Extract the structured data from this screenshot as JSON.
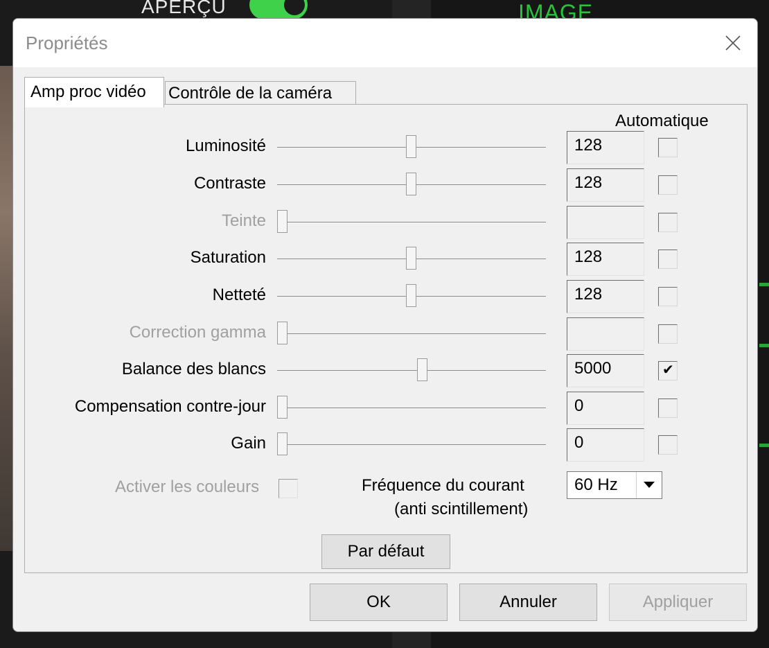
{
  "background": {
    "preview_label": "APERÇU",
    "image_label": "IMAGE",
    "preview_toggle_on": true
  },
  "dialog": {
    "title": "Propriétés",
    "close_icon": "close-icon",
    "tabs": [
      {
        "label": "Amp proc vidéo",
        "active": true
      },
      {
        "label": "Contrôle de la caméra",
        "active": false
      }
    ],
    "auto_header": "Automatique",
    "properties": [
      {
        "label": "Luminosité",
        "value": "128",
        "slider_fraction": 0.5,
        "auto": false,
        "enabled": true
      },
      {
        "label": "Contraste",
        "value": "128",
        "slider_fraction": 0.5,
        "auto": false,
        "enabled": true
      },
      {
        "label": "Teinte",
        "value": "",
        "slider_fraction": 0.02,
        "auto": false,
        "enabled": false
      },
      {
        "label": "Saturation",
        "value": "128",
        "slider_fraction": 0.5,
        "auto": false,
        "enabled": true
      },
      {
        "label": "Netteté",
        "value": "128",
        "slider_fraction": 0.5,
        "auto": false,
        "enabled": true
      },
      {
        "label": "Correction gamma",
        "value": "",
        "slider_fraction": 0.02,
        "auto": false,
        "enabled": false
      },
      {
        "label": "Balance des blancs",
        "value": "5000",
        "slider_fraction": 0.54,
        "auto": true,
        "enabled": true
      },
      {
        "label": "Compensation contre-jour",
        "value": "0",
        "slider_fraction": 0.02,
        "auto": false,
        "enabled": true
      },
      {
        "label": "Gain",
        "value": "0",
        "slider_fraction": 0.02,
        "auto": false,
        "enabled": true
      }
    ],
    "enable_colors_label": "Activer les couleurs",
    "frequency_label": "Fréquence du courant",
    "frequency_sublabel": "(anti scintillement)",
    "frequency_value": "60 Hz",
    "default_button": "Par défaut",
    "ok_button": "OK",
    "cancel_button": "Annuler",
    "apply_button": "Appliquer"
  }
}
